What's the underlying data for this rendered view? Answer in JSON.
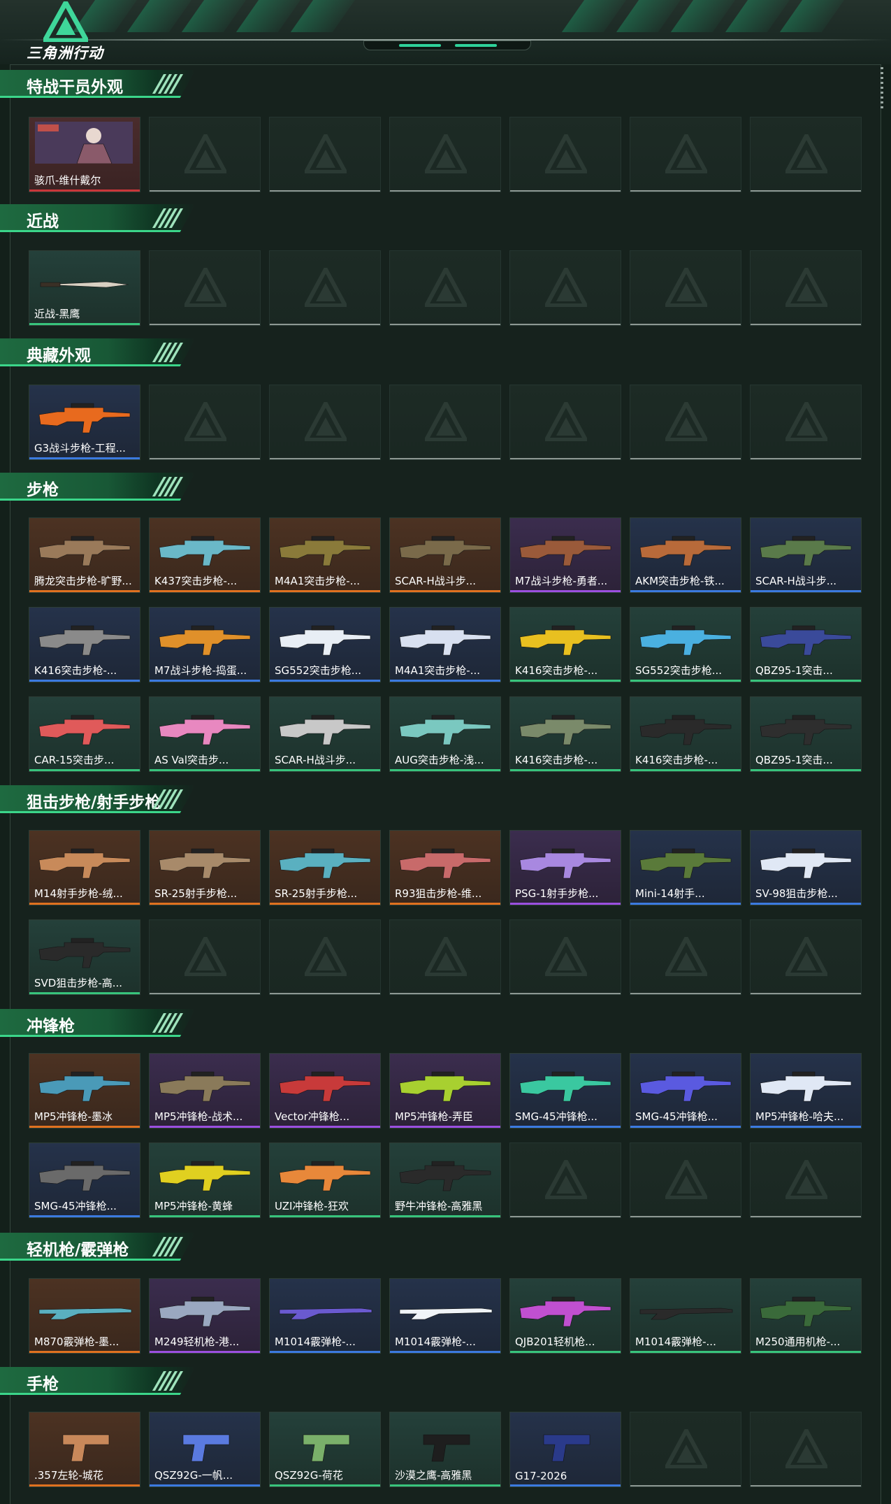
{
  "app": {
    "logo_text": "三角洲行动"
  },
  "colors": {
    "red": "#c8363a",
    "orange": "#e0711f",
    "purple": "#9b4fe0",
    "blue": "#3b7ae0",
    "green": "#38c47c",
    "empty": "#8d9893"
  },
  "sections": [
    {
      "id": "operator-skins",
      "title": "特战干员外观",
      "slots": 7,
      "items": [
        {
          "name": "骇爪-维什戴尔",
          "rarity": "red",
          "icon": "operator-portrait-icon",
          "tint": "#8a5a6a"
        }
      ]
    },
    {
      "id": "melee",
      "title": "近战",
      "slots": 7,
      "items": [
        {
          "name": "近战-黑鹰",
          "rarity": "green",
          "icon": "knife-icon",
          "tint": "#d8d0c2"
        }
      ]
    },
    {
      "id": "collection",
      "title": "典藏外观",
      "slots": 7,
      "items": [
        {
          "name": "G3战斗步枪-工程...",
          "rarity": "blue",
          "icon": "rifle-icon",
          "tint": "#e86a1e"
        }
      ]
    },
    {
      "id": "rifles",
      "title": "步枪",
      "slots": 21,
      "items": [
        {
          "name": "腾龙突击步枪-旷野...",
          "rarity": "orange",
          "icon": "rifle-icon",
          "tint": "#9a7a5a"
        },
        {
          "name": "K437突击步枪-...",
          "rarity": "orange",
          "icon": "rifle-icon",
          "tint": "#6ab8c8"
        },
        {
          "name": "M4A1突击步枪-...",
          "rarity": "orange",
          "icon": "rifle-icon",
          "tint": "#8a7a3a"
        },
        {
          "name": "SCAR-H战斗步...",
          "rarity": "orange",
          "icon": "rifle-icon",
          "tint": "#7a6a4a"
        },
        {
          "name": "M7战斗步枪-勇者...",
          "rarity": "purple",
          "icon": "rifle-icon",
          "tint": "#9a5a3a"
        },
        {
          "name": "AKM突击步枪-铁...",
          "rarity": "blue",
          "icon": "rifle-icon",
          "tint": "#b86a3a"
        },
        {
          "name": "SCAR-H战斗步...",
          "rarity": "blue",
          "icon": "rifle-icon",
          "tint": "#5a7a4a"
        },
        {
          "name": "K416突击步枪-...",
          "rarity": "blue",
          "icon": "rifle-icon",
          "tint": "#8a8a8a"
        },
        {
          "name": "M7战斗步枪-捣蛋...",
          "rarity": "blue",
          "icon": "rifle-icon",
          "tint": "#e0902a"
        },
        {
          "name": "SG552突击步枪...",
          "rarity": "blue",
          "icon": "rifle-icon",
          "tint": "#e8eef5"
        },
        {
          "name": "M4A1突击步枪-...",
          "rarity": "blue",
          "icon": "rifle-icon",
          "tint": "#d8e0f0"
        },
        {
          "name": "K416突击步枪-...",
          "rarity": "green",
          "icon": "rifle-icon",
          "tint": "#e8c020"
        },
        {
          "name": "SG552突击步枪...",
          "rarity": "green",
          "icon": "rifle-icon",
          "tint": "#4ab0e0"
        },
        {
          "name": "QBZ95-1突击...",
          "rarity": "green",
          "icon": "rifle-icon",
          "tint": "#3a4a9a"
        },
        {
          "name": "CAR-15突击步...",
          "rarity": "green",
          "icon": "rifle-icon",
          "tint": "#e05a5a"
        },
        {
          "name": "AS Val突击步...",
          "rarity": "green",
          "icon": "rifle-icon",
          "tint": "#e888c0"
        },
        {
          "name": "SCAR-H战斗步...",
          "rarity": "green",
          "icon": "rifle-icon",
          "tint": "#c8c8c8"
        },
        {
          "name": "AUG突击步枪-浅...",
          "rarity": "green",
          "icon": "rifle-icon",
          "tint": "#7ac8c0"
        },
        {
          "name": "K416突击步枪-...",
          "rarity": "green",
          "icon": "rifle-icon",
          "tint": "#7a8a6a"
        },
        {
          "name": "K416突击步枪-...",
          "rarity": "green",
          "icon": "rifle-icon",
          "tint": "#2a2a2a"
        },
        {
          "name": "QBZ95-1突击...",
          "rarity": "green",
          "icon": "rifle-icon",
          "tint": "#2e2e2e"
        }
      ]
    },
    {
      "id": "snipers",
      "title": "狙击步枪/射手步枪",
      "slots": 14,
      "items": [
        {
          "name": "M14射手步枪-绒...",
          "rarity": "orange",
          "icon": "sniper-icon",
          "tint": "#c88a5a"
        },
        {
          "name": "SR-25射手步枪...",
          "rarity": "orange",
          "icon": "sniper-icon",
          "tint": "#a88a6a"
        },
        {
          "name": "SR-25射手步枪...",
          "rarity": "orange",
          "icon": "sniper-icon",
          "tint": "#5ab0c0"
        },
        {
          "name": "R93狙击步枪-维...",
          "rarity": "orange",
          "icon": "sniper-icon",
          "tint": "#c86a6a"
        },
        {
          "name": "PSG-1射手步枪...",
          "rarity": "purple",
          "icon": "sniper-icon",
          "tint": "#a888e0"
        },
        {
          "name": "Mini-14射手...",
          "rarity": "blue",
          "icon": "sniper-icon",
          "tint": "#5a7a3a"
        },
        {
          "name": "SV-98狙击步枪...",
          "rarity": "blue",
          "icon": "sniper-icon",
          "tint": "#e0e8f5"
        },
        {
          "name": "SVD狙击步枪-高...",
          "rarity": "green",
          "icon": "sniper-icon",
          "tint": "#2a2a2a"
        }
      ]
    },
    {
      "id": "smgs",
      "title": "冲锋枪",
      "slots": 14,
      "items": [
        {
          "name": "MP5冲锋枪-墨冰",
          "rarity": "orange",
          "icon": "smg-icon",
          "tint": "#4a9ab8"
        },
        {
          "name": "MP5冲锋枪-战术...",
          "rarity": "purple",
          "icon": "smg-icon",
          "tint": "#8a7a5a"
        },
        {
          "name": "Vector冲锋枪...",
          "rarity": "purple",
          "icon": "smg-icon",
          "tint": "#c83a3a"
        },
        {
          "name": "MP5冲锋枪-弄臣",
          "rarity": "purple",
          "icon": "smg-icon",
          "tint": "#a8d030"
        },
        {
          "name": "SMG-45冲锋枪...",
          "rarity": "blue",
          "icon": "smg-icon",
          "tint": "#3ac8a0"
        },
        {
          "name": "SMG-45冲锋枪...",
          "rarity": "blue",
          "icon": "smg-icon",
          "tint": "#5a5ae0"
        },
        {
          "name": "MP5冲锋枪-哈夫...",
          "rarity": "blue",
          "icon": "smg-icon",
          "tint": "#e0e8f5"
        },
        {
          "name": "SMG-45冲锋枪...",
          "rarity": "blue",
          "icon": "smg-icon",
          "tint": "#6a6a6a"
        },
        {
          "name": "MP5冲锋枪-黄蜂",
          "rarity": "green",
          "icon": "smg-icon",
          "tint": "#e0d020"
        },
        {
          "name": "UZI冲锋枪-狂欢",
          "rarity": "green",
          "icon": "smg-icon",
          "tint": "#e8883a"
        },
        {
          "name": "野牛冲锋枪-高雅黑",
          "rarity": "green",
          "icon": "smg-icon",
          "tint": "#2a2a2a"
        }
      ]
    },
    {
      "id": "lmg-shotguns",
      "title": "轻机枪/霰弹枪",
      "slots": 7,
      "items": [
        {
          "name": "M870霰弹枪-墨...",
          "rarity": "orange",
          "icon": "shotgun-icon",
          "tint": "#5ab0c0"
        },
        {
          "name": "M249轻机枪-港...",
          "rarity": "purple",
          "icon": "lmg-icon",
          "tint": "#9aa8c0"
        },
        {
          "name": "M1014霰弹枪-...",
          "rarity": "blue",
          "icon": "shotgun-icon",
          "tint": "#6a5ad0"
        },
        {
          "name": "M1014霰弹枪-...",
          "rarity": "blue",
          "icon": "shotgun-icon",
          "tint": "#f0f4f8"
        },
        {
          "name": "QJB201轻机枪...",
          "rarity": "green",
          "icon": "lmg-icon",
          "tint": "#c050d0"
        },
        {
          "name": "M1014霰弹枪-...",
          "rarity": "green",
          "icon": "shotgun-icon",
          "tint": "#2a2a2a"
        },
        {
          "name": "M250通用机枪-...",
          "rarity": "green",
          "icon": "lmg-icon",
          "tint": "#3a6a3a"
        }
      ]
    },
    {
      "id": "pistols",
      "title": "手枪",
      "slots": 7,
      "items": [
        {
          "name": ".357左轮-城花",
          "rarity": "orange",
          "icon": "revolver-icon",
          "tint": "#c8885a"
        },
        {
          "name": "QSZ92G-一帆...",
          "rarity": "blue",
          "icon": "pistol-icon",
          "tint": "#5a7ae0"
        },
        {
          "name": "QSZ92G-荷花",
          "rarity": "green",
          "icon": "pistol-icon",
          "tint": "#7ab06a"
        },
        {
          "name": "沙漠之鹰-高雅黑",
          "rarity": "green",
          "icon": "pistol-icon",
          "tint": "#1e1e1e"
        },
        {
          "name": "G17-2026",
          "rarity": "blue",
          "icon": "pistol-icon",
          "tint": "#2a3a8a"
        }
      ]
    }
  ]
}
